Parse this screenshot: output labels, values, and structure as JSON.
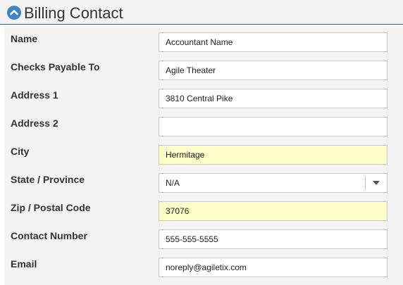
{
  "section": {
    "title": "Billing Contact"
  },
  "form": {
    "fields": [
      {
        "label": "Name",
        "value": "Accountant Name"
      },
      {
        "label": "Checks Payable To",
        "value": "Agile Theater"
      },
      {
        "label": "Address 1",
        "value": "3810 Central Pike"
      },
      {
        "label": "Address 2",
        "value": ""
      },
      {
        "label": "City",
        "value": "Hermitage",
        "highlighted": true
      },
      {
        "label": "State / Province",
        "value": "N/A",
        "type": "select"
      },
      {
        "label": "Zip / Postal Code",
        "value": "37076",
        "highlighted": true
      },
      {
        "label": "Contact Number",
        "value": "555-555-5555"
      },
      {
        "label": "Email",
        "value": "noreply@agiletix.com"
      }
    ]
  },
  "colors": {
    "accent": "#3f84c5",
    "header_rule": "#3c5a86",
    "highlight_field": "#fdfdc7",
    "panel_bg": "#f4f4f4"
  },
  "icons": {
    "collapse": "chevron-up-icon",
    "dropdown": "caret-down-icon"
  }
}
